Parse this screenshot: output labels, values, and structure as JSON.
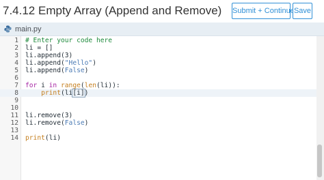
{
  "header": {
    "title": "7.4.12 Empty Array (Append and Remove)",
    "submit_label": "Submit + Continue",
    "save_label": "Save"
  },
  "tab": {
    "filename": "main.py",
    "icon": "python-icon"
  },
  "editor": {
    "active_line": 8,
    "lines": [
      {
        "num": "1",
        "text": "# Enter your code here"
      },
      {
        "num": "2",
        "text": "li = []"
      },
      {
        "num": "3",
        "text": "li.append(3)"
      },
      {
        "num": "4",
        "text": "li.append(\"Hello\")"
      },
      {
        "num": "5",
        "text": "li.append(False)"
      },
      {
        "num": "6",
        "text": ""
      },
      {
        "num": "7",
        "text": "for i in range(len(li)):"
      },
      {
        "num": "8",
        "text": "    print(li[i])"
      },
      {
        "num": "9",
        "text": ""
      },
      {
        "num": "10",
        "text": ""
      },
      {
        "num": "11",
        "text": "li.remove(3)"
      },
      {
        "num": "12",
        "text": "li.remove(False)"
      },
      {
        "num": "13",
        "text": ""
      },
      {
        "num": "14",
        "text": "print(li)"
      }
    ]
  },
  "colors": {
    "accent": "#2f8fd6",
    "comment": "#1e8a3c",
    "keyword": "#a625a4",
    "builtin": "#c57f1f",
    "string": "#4b7bb5"
  }
}
